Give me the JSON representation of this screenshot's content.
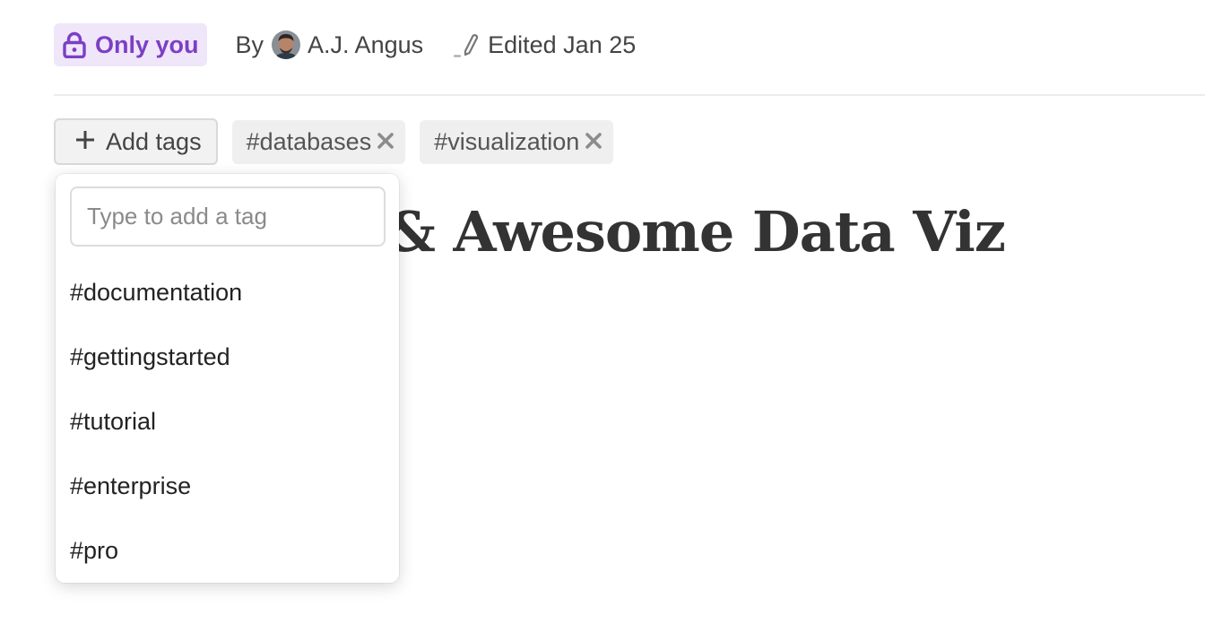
{
  "header": {
    "privacy_label": "Only you",
    "privacy_icon": "lock-icon",
    "privacy_color": "#7b3fc4",
    "privacy_bg": "#efe6fa",
    "by_label": "By",
    "author_name": "A.J. Angus",
    "edited_icon": "pencil-icon",
    "edited_label": "Edited Jan 25"
  },
  "tags": {
    "add_button_label": "Add tags",
    "applied": [
      {
        "label": "#databases"
      },
      {
        "label": "#visualization"
      }
    ]
  },
  "document": {
    "title_visible": "& Awesome Data Viz"
  },
  "tag_dropdown": {
    "input_placeholder": "Type to add a tag",
    "input_value": "",
    "suggestions": [
      {
        "label": "#documentation"
      },
      {
        "label": "#gettingstarted"
      },
      {
        "label": "#tutorial"
      },
      {
        "label": "#enterprise"
      },
      {
        "label": "#pro"
      }
    ]
  }
}
